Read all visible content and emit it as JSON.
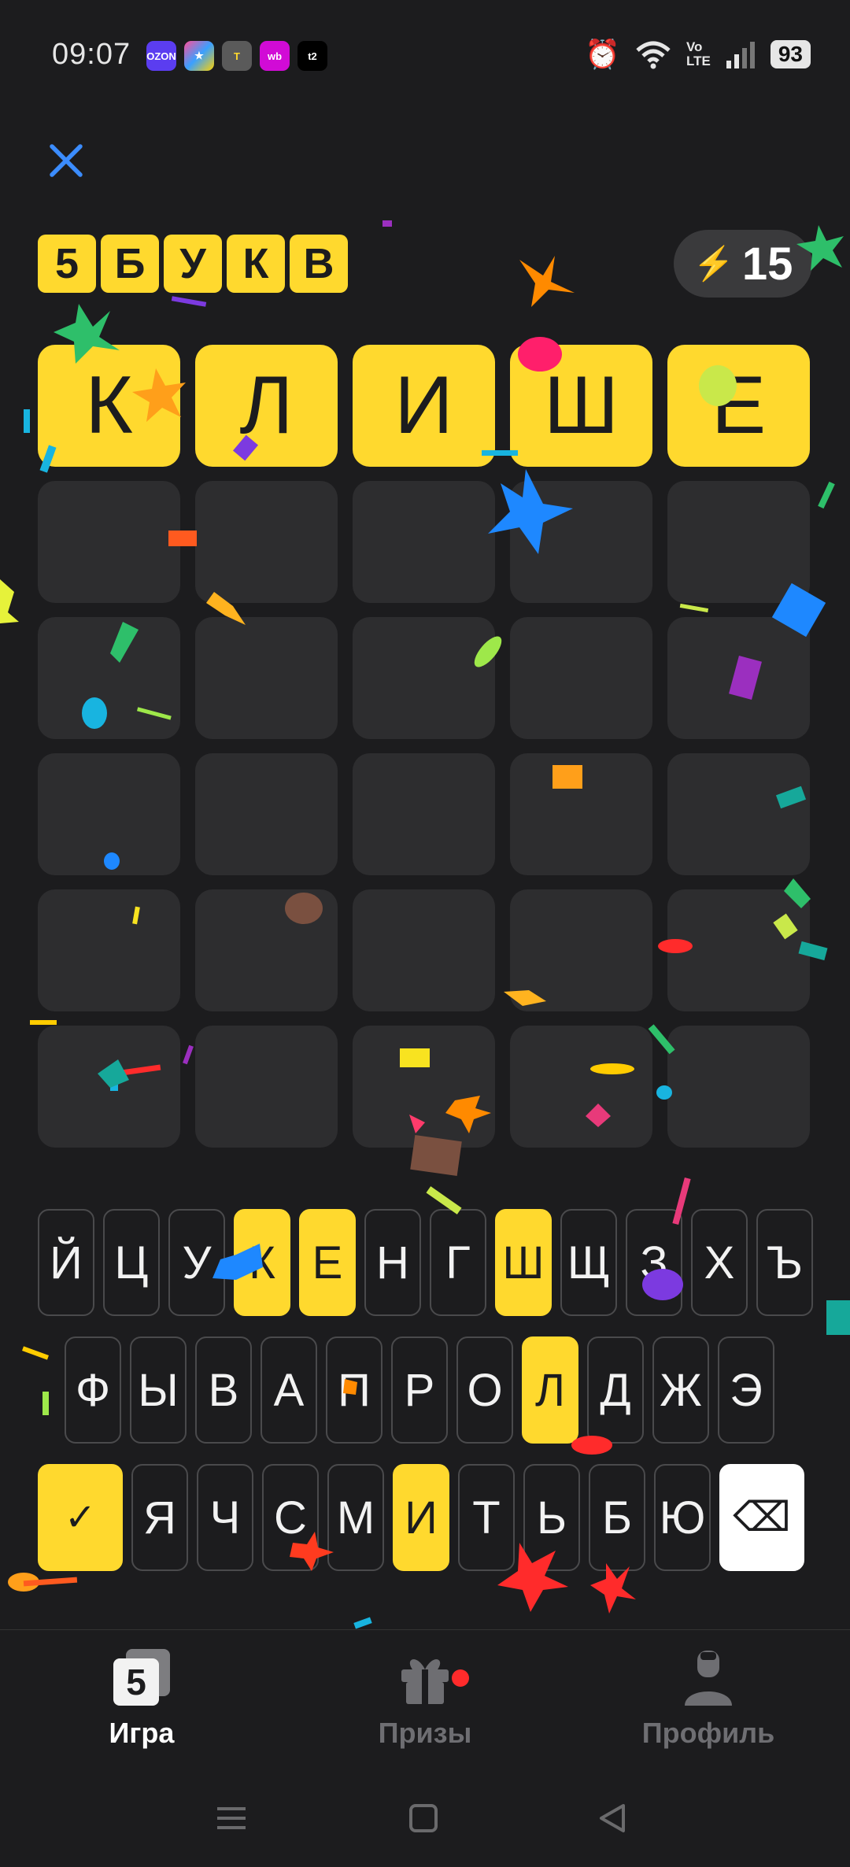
{
  "status_bar": {
    "time": "09:07",
    "apps": [
      "OZON",
      "★",
      "Т",
      "wb",
      "t2"
    ],
    "volte": "Vo\nLTE",
    "battery": "93"
  },
  "game": {
    "badge_letters": [
      "5",
      "Б",
      "У",
      "К",
      "В"
    ],
    "energy": "15",
    "grid": [
      [
        "К",
        "Л",
        "И",
        "Ш",
        "Е"
      ],
      [
        "",
        "",
        "",
        "",
        ""
      ],
      [
        "",
        "",
        "",
        "",
        ""
      ],
      [
        "",
        "",
        "",
        "",
        ""
      ],
      [
        "",
        "",
        "",
        "",
        ""
      ],
      [
        "",
        "",
        "",
        "",
        ""
      ]
    ],
    "keyboard": {
      "row1": [
        "Й",
        "Ц",
        "У",
        "К",
        "Е",
        "Н",
        "Г",
        "Ш",
        "Щ",
        "З",
        "Х",
        "Ъ"
      ],
      "row2": [
        "Ф",
        "Ы",
        "В",
        "А",
        "П",
        "Р",
        "О",
        "Л",
        "Д",
        "Ж",
        "Э"
      ],
      "row3": [
        "Я",
        "Ч",
        "С",
        "М",
        "И",
        "Т",
        "Ь",
        "Б",
        "Ю"
      ],
      "highlighted": [
        "К",
        "Е",
        "Ш",
        "Л",
        "И"
      ],
      "enter_symbol": "✓",
      "backspace_symbol": "⌫"
    }
  },
  "bottom_nav": {
    "game_label": "Игра",
    "game_icon_text": "5",
    "prizes_label": "Призы",
    "profile_label": "Профиль"
  },
  "colors": {
    "accent_yellow": "#ffd92e",
    "close_blue": "#3b8cff",
    "background": "#1c1c1e",
    "empty_cell": "#2d2d2f",
    "notification_dot": "#ff2b2b"
  }
}
